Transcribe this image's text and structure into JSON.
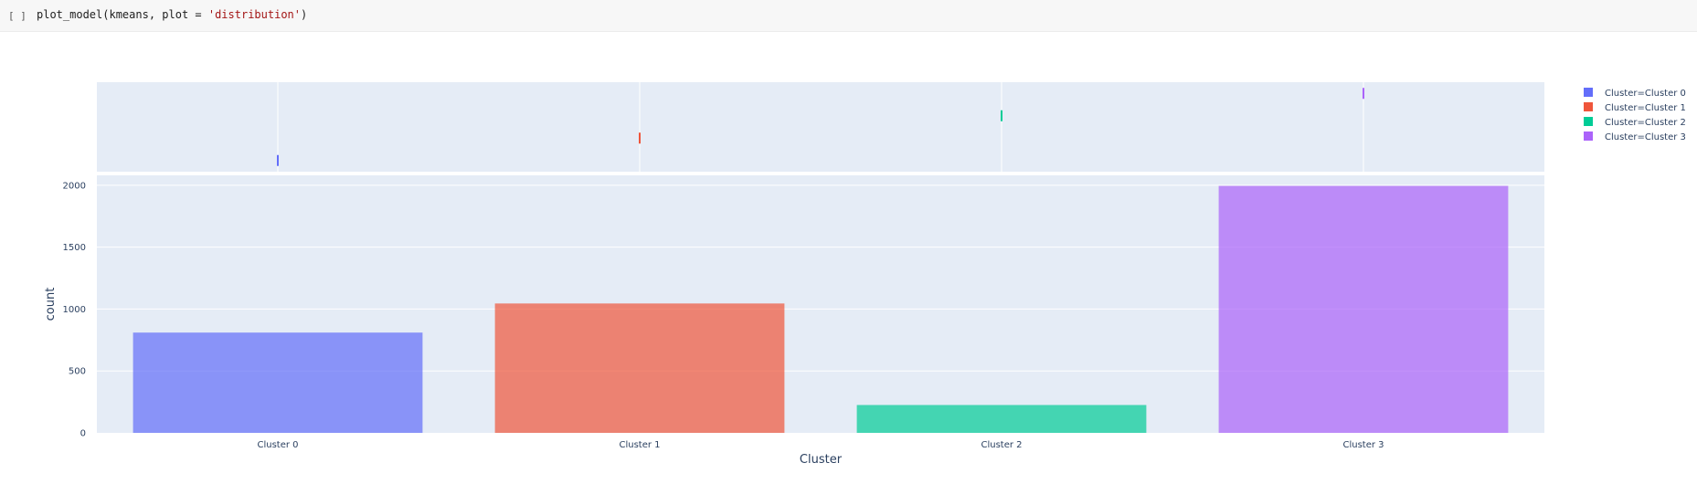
{
  "cell": {
    "prompt": "[ ]",
    "code_before": "plot_model(kmeans, plot = ",
    "code_string": "'distribution'",
    "code_after": ")"
  },
  "chart_data": {
    "type": "bar",
    "xlabel": "Cluster",
    "ylabel": "count",
    "categories": [
      "Cluster 0",
      "Cluster 1",
      "Cluster 2",
      "Cluster 3"
    ],
    "values": [
      810,
      1045,
      225,
      1995
    ],
    "ylim": [
      0,
      2080
    ],
    "yticks": [
      0,
      500,
      1000,
      1500,
      2000
    ],
    "colors": [
      "#636efa",
      "#ef553b",
      "#00cc96",
      "#ab63fa"
    ],
    "legend": [
      "Cluster=Cluster 0",
      "Cluster=Cluster 1",
      "Cluster=Cluster 2",
      "Cluster=Cluster 3"
    ],
    "legend_position": "top-right",
    "marginal": "rug",
    "grid": true
  }
}
